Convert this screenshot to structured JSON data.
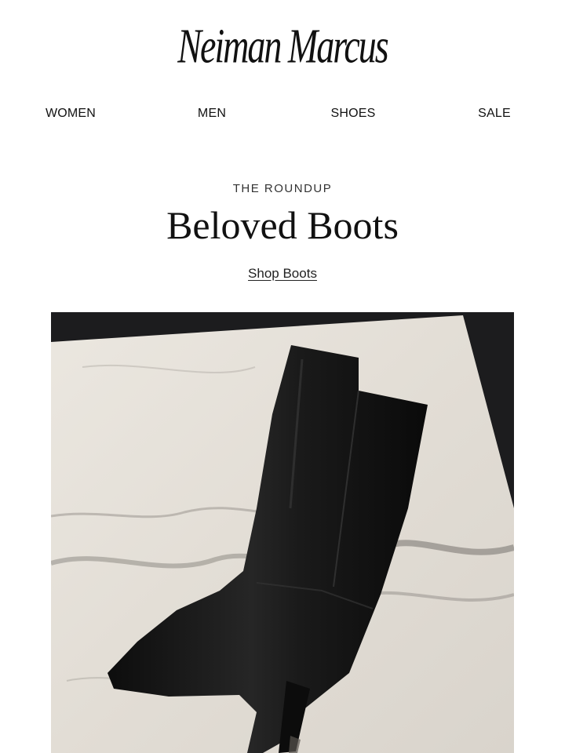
{
  "brand": {
    "logo_text": "Neiman Marcus"
  },
  "nav": {
    "items": [
      "WOMEN",
      "MEN",
      "SHOES",
      "SALE"
    ]
  },
  "hero": {
    "eyebrow": "THE ROUNDUP",
    "headline": "Beloved Boots",
    "cta_label": "Shop Boots",
    "image_icon": "boot-photo"
  },
  "colors": {
    "text": "#111111",
    "marble": "#e7e3dc",
    "boot": "#141414"
  }
}
